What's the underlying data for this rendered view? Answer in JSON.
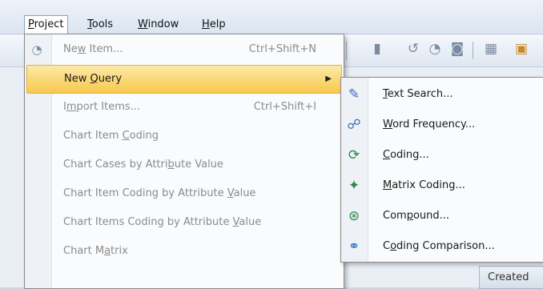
{
  "menubar": {
    "items": [
      {
        "label": "Project",
        "underline": "P"
      },
      {
        "label": "Tools",
        "underline": "T"
      },
      {
        "label": "Window",
        "underline": "W"
      },
      {
        "label": "Help",
        "underline": "H"
      }
    ]
  },
  "project_menu": {
    "items": [
      {
        "pre": "Ne",
        "u": "w",
        "post": " Item...",
        "shortcut": "Ctrl+Shift+N",
        "state": "disabled",
        "icon": "new-item-icon"
      },
      {
        "pre": "New ",
        "u": "Q",
        "post": "uery",
        "shortcut": "",
        "state": "highlighted",
        "submenu": true
      },
      {
        "pre": "I",
        "u": "m",
        "post": "port Items...",
        "shortcut": "Ctrl+Shift+I",
        "state": "disabled"
      },
      {
        "pre": "Chart Item ",
        "u": "C",
        "post": "oding",
        "shortcut": "",
        "state": "disabled"
      },
      {
        "pre": "Chart Cases by Attri",
        "u": "b",
        "post": "ute Value",
        "shortcut": "",
        "state": "disabled"
      },
      {
        "pre": "Chart Item Coding by Attribute ",
        "u": "V",
        "post": "alue",
        "shortcut": "",
        "state": "disabled"
      },
      {
        "pre": "Chart Items Coding by Attribute ",
        "u": "V",
        "post": "alue",
        "shortcut": "",
        "state": "disabled"
      },
      {
        "pre": "Chart M",
        "u": "a",
        "post": "trix",
        "shortcut": "",
        "state": "disabled"
      }
    ]
  },
  "new_query_menu": {
    "items": [
      {
        "pre": "",
        "u": "T",
        "post": "ext Search...",
        "icon": "text-search-icon",
        "color": "#3a6fb5"
      },
      {
        "pre": "",
        "u": "W",
        "post": "ord Frequency...",
        "icon": "word-frequency-icon",
        "color": "#3a6fb5"
      },
      {
        "pre": "",
        "u": "C",
        "post": "oding...",
        "icon": "coding-query-icon",
        "color": "#2f8a4a"
      },
      {
        "pre": "",
        "u": "M",
        "post": "atrix Coding...",
        "icon": "matrix-coding-icon",
        "color": "#2f8a4a"
      },
      {
        "pre": "Com",
        "u": "p",
        "post": "ound...",
        "icon": "compound-query-icon",
        "color": "#2f8a4a"
      },
      {
        "pre": "C",
        "u": "o",
        "post": "ding Comparison...",
        "icon": "coding-comparison-icon",
        "color": "#3a6fb5"
      }
    ]
  },
  "background": {
    "created_tab": "Created"
  },
  "colors": {
    "highlight": "#f7c94b",
    "disabled_text": "#8b8b8b"
  }
}
